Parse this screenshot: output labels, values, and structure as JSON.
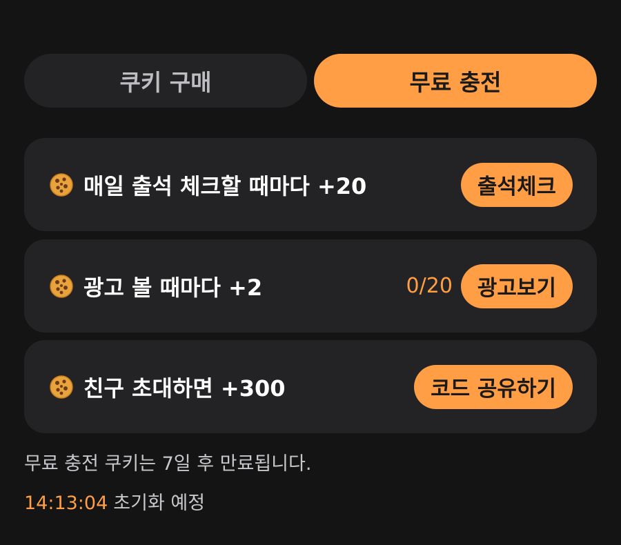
{
  "tabs": [
    {
      "label": "쿠키 구매",
      "active": false
    },
    {
      "label": "무료 충전",
      "active": true
    }
  ],
  "cards": [
    {
      "icon": "cookie-icon",
      "title": "매일 출석 체크할 때마다 +20",
      "counter": "",
      "button": "출석체크"
    },
    {
      "icon": "cookie-icon",
      "title": "광고 볼 때마다 +2",
      "counter": "0/20",
      "button": "광고보기"
    },
    {
      "icon": "cookie-icon",
      "title": "친구 초대하면 +300",
      "counter": "",
      "button": "코드 공유하기"
    }
  ],
  "footer": {
    "note": "무료 충전 쿠키는 7일 후 만료됩니다.",
    "reset_time": "14:13:04",
    "reset_label": "초기화 예정"
  },
  "colors": {
    "background": "#141414",
    "card": "#232325",
    "accent": "#ff9e45",
    "inactive_tab_text": "#bdbdc2"
  }
}
